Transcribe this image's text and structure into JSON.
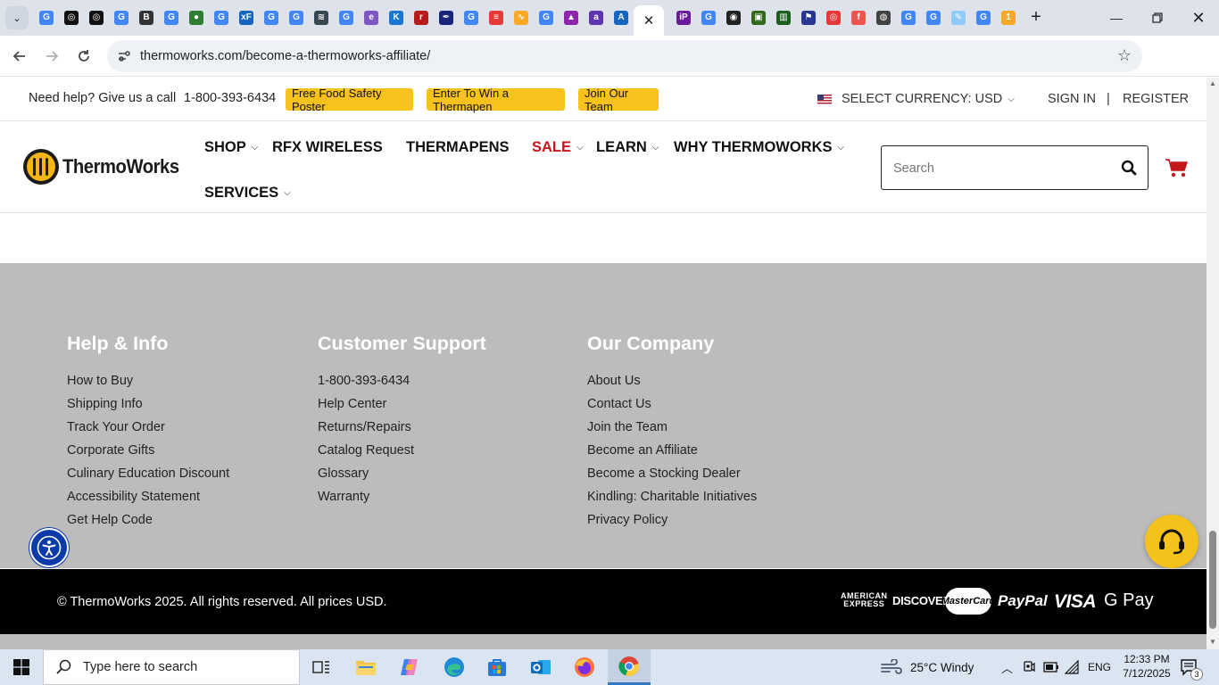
{
  "browser": {
    "url": "thermoworks.com/become-a-thermoworks-affiliate/",
    "tab_favicons": [
      {
        "icon": "google-icon",
        "color": "#4285f4",
        "glyph": "G"
      },
      {
        "icon": "openai-icon",
        "color": "#111111",
        "glyph": "◎"
      },
      {
        "icon": "openai-icon",
        "color": "#111111",
        "glyph": "◎"
      },
      {
        "icon": "google-icon",
        "color": "#4285f4",
        "glyph": "G"
      },
      {
        "icon": "b-icon",
        "color": "#333333",
        "glyph": "B"
      },
      {
        "icon": "google-icon",
        "color": "#4285f4",
        "glyph": "G"
      },
      {
        "icon": "globe-icon",
        "color": "#2e7d32",
        "glyph": "●"
      },
      {
        "icon": "google-icon",
        "color": "#4285f4",
        "glyph": "G"
      },
      {
        "icon": "xf-icon",
        "color": "#1565c0",
        "glyph": "xF"
      },
      {
        "icon": "google-icon",
        "color": "#4285f4",
        "glyph": "G"
      },
      {
        "icon": "google-icon",
        "color": "#4285f4",
        "glyph": "G"
      },
      {
        "icon": "layers-icon",
        "color": "#37474f",
        "glyph": "≋"
      },
      {
        "icon": "google-icon",
        "color": "#4285f4",
        "glyph": "G"
      },
      {
        "icon": "e-icon",
        "color": "#7e57c2",
        "glyph": "e"
      },
      {
        "icon": "k-icon",
        "color": "#1976d2",
        "glyph": "K"
      },
      {
        "icon": "r-icon",
        "color": "#b71c1c",
        "glyph": "r"
      },
      {
        "icon": "pen-icon",
        "color": "#1a237e",
        "glyph": "✒"
      },
      {
        "icon": "google-icon",
        "color": "#4285f4",
        "glyph": "G"
      },
      {
        "icon": "lines-icon",
        "color": "#e53935",
        "glyph": "≡"
      },
      {
        "icon": "wave-icon",
        "color": "#f9a825",
        "glyph": "∿"
      },
      {
        "icon": "google-icon",
        "color": "#4285f4",
        "glyph": "G"
      },
      {
        "icon": "cap-icon",
        "color": "#8e24aa",
        "glyph": "▲"
      },
      {
        "icon": "alt-icon",
        "color": "#5e35b1",
        "glyph": "a"
      },
      {
        "icon": "an-icon",
        "color": "#1565c0",
        "glyph": "A"
      }
    ],
    "tab_favicons_right": [
      {
        "icon": "ip-icon",
        "color": "#6a1b9a",
        "glyph": "iP"
      },
      {
        "icon": "google-icon",
        "color": "#4285f4",
        "glyph": "G"
      },
      {
        "icon": "ball-icon",
        "color": "#212121",
        "glyph": "◉"
      },
      {
        "icon": "notes-icon",
        "color": "#33691e",
        "glyph": "▣"
      },
      {
        "icon": "chart-icon",
        "color": "#1b5e20",
        "glyph": "▥"
      },
      {
        "icon": "flag-icon",
        "color": "#283593",
        "glyph": "⚑"
      },
      {
        "icon": "record-icon",
        "color": "#e53935",
        "glyph": "◎"
      },
      {
        "icon": "f-icon",
        "color": "#ef5350",
        "glyph": "f"
      },
      {
        "icon": "globe-icon",
        "color": "#424242",
        "glyph": "◍"
      },
      {
        "icon": "google-icon",
        "color": "#4285f4",
        "glyph": "G"
      },
      {
        "icon": "google-icon",
        "color": "#4285f4",
        "glyph": "G"
      },
      {
        "icon": "pencil-icon",
        "color": "#90caf9",
        "glyph": "✎"
      },
      {
        "icon": "google-icon",
        "color": "#4285f4",
        "glyph": "G"
      },
      {
        "icon": "one-icon",
        "color": "#f9a825",
        "glyph": "1"
      }
    ]
  },
  "topbar": {
    "help_text": "Need help? Give us a call",
    "phone": "1-800-393-6434",
    "promo_poster": "Free Food Safety Poster",
    "promo_win": "Enter To Win a Thermapen",
    "promo_team": "Join Our Team",
    "currency": "SELECT CURRENCY: USD",
    "sign_in": "SIGN IN",
    "separator": "|",
    "register": "REGISTER"
  },
  "header": {
    "logo_text": "ThermoWorks",
    "nav": {
      "shop": "SHOP",
      "rfx": "RFX WIRELESS",
      "thermapens": "THERMAPENS",
      "sale": "SALE",
      "learn": "LEARN",
      "why": "WHY THERMOWORKS",
      "services": "SERVICES"
    },
    "search_placeholder": "Search",
    "brand_color": "#f5b516",
    "sale_color": "#c4161c"
  },
  "footer": {
    "columns": [
      {
        "heading": "Help & Info",
        "links": [
          "How to Buy",
          "Shipping Info",
          "Track Your Order",
          "Corporate Gifts",
          "Culinary Education Discount",
          "Accessibility Statement",
          "Get Help Code"
        ]
      },
      {
        "heading": "Customer Support",
        "links": [
          "1-800-393-6434",
          "Help Center",
          "Returns/Repairs",
          "Catalog Request",
          "Glossary",
          "Warranty"
        ]
      },
      {
        "heading": "Our Company",
        "links": [
          "About Us",
          "Contact Us",
          "Join the Team",
          "Become an Affiliate",
          "Become a Stocking Dealer",
          "Kindling: Charitable Initiatives",
          "Privacy Policy"
        ]
      }
    ],
    "copyright": "© ThermoWorks 2025. All rights reserved. All prices USD.",
    "payments": {
      "amex_line1": "AMERICAN",
      "amex_line2": "EXPRESS",
      "discover": "DISCOVER",
      "mastercard": "MasterCard",
      "paypal": "PayPal",
      "visa": "VISA",
      "gpay": "G Pay"
    }
  },
  "taskbar": {
    "search_placeholder": "Type here to search",
    "weather": "25°C  Windy",
    "language": "ENG",
    "time": "12:33 PM",
    "date": "7/12/2025",
    "notification_count": "3"
  }
}
